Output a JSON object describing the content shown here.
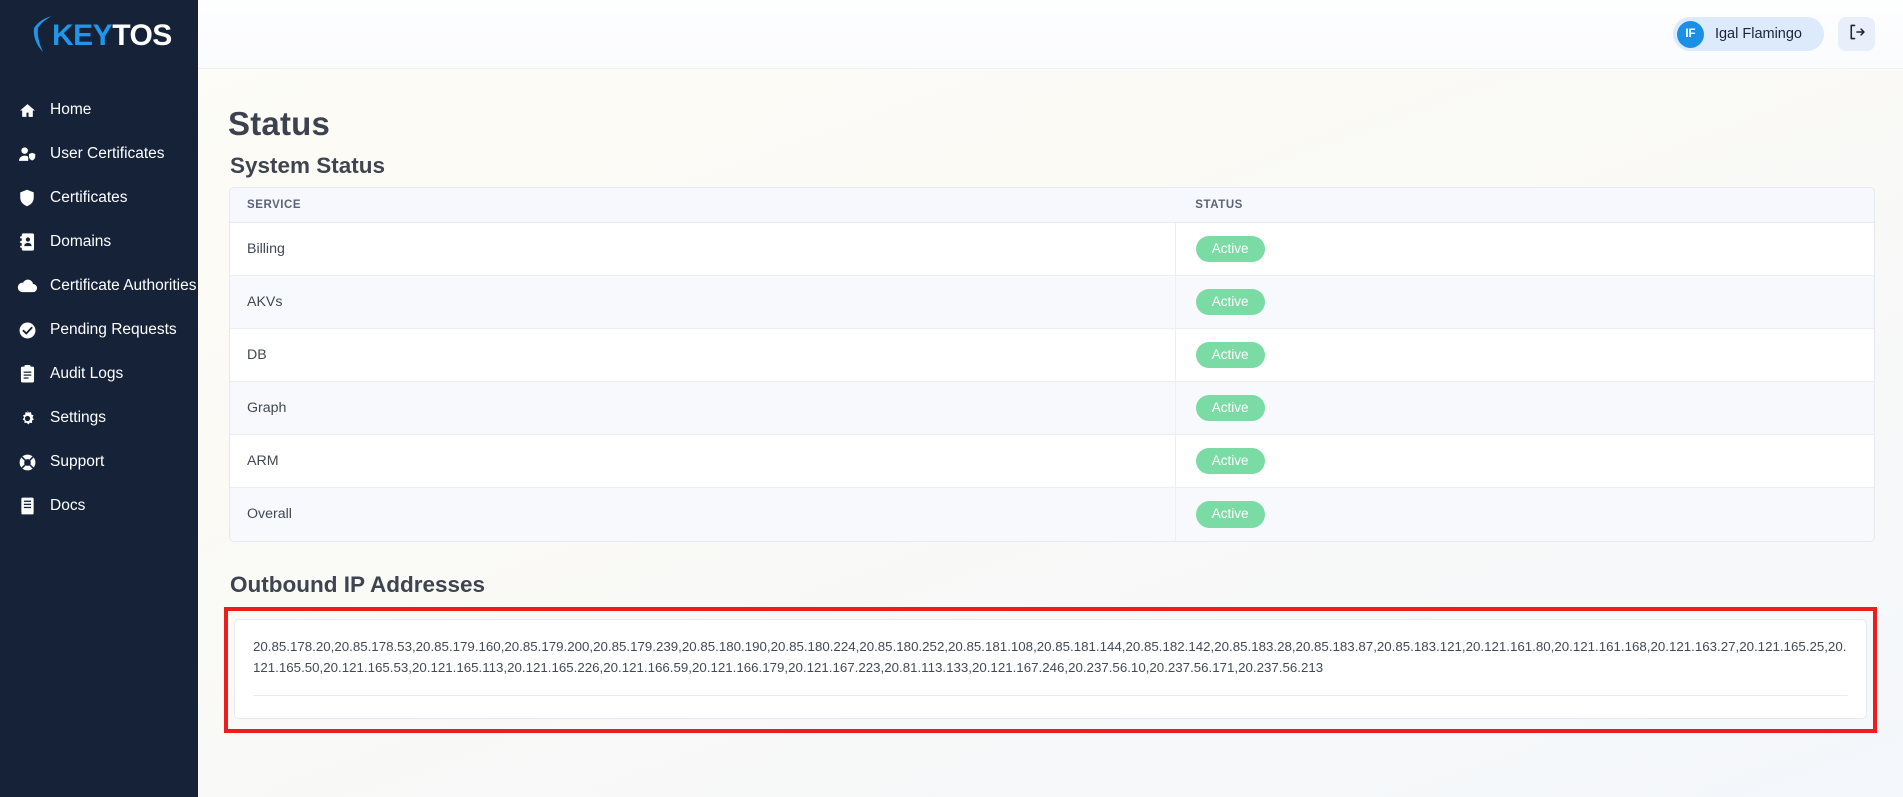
{
  "brand": {
    "logo_primary": "KEY",
    "logo_secondary": "TOS",
    "logo_primary_color": "#2196e8",
    "logo_secondary_color": "#ffffff",
    "sidebar_bg": "#152238"
  },
  "sidebar": {
    "items": [
      {
        "label": "Home",
        "icon": "home-icon"
      },
      {
        "label": "User Certificates",
        "icon": "user-shield-icon"
      },
      {
        "label": "Certificates",
        "icon": "shield-icon"
      },
      {
        "label": "Domains",
        "icon": "address-book-icon"
      },
      {
        "label": "Certificate Authorities",
        "icon": "cloud-icon"
      },
      {
        "label": "Pending Requests",
        "icon": "check-circle-icon"
      },
      {
        "label": "Audit Logs",
        "icon": "clipboard-icon"
      },
      {
        "label": "Settings",
        "icon": "gear-icon"
      },
      {
        "label": "Support",
        "icon": "life-ring-icon"
      },
      {
        "label": "Docs",
        "icon": "book-icon"
      }
    ]
  },
  "topbar": {
    "user_initials": "IF",
    "user_name": "Igal Flamingo",
    "avatar_color": "#1a8fe8",
    "signout_icon": "sign-out-icon"
  },
  "page": {
    "title": "Status",
    "system_status_heading": "System Status",
    "outbound_heading": "Outbound IP Addresses"
  },
  "table": {
    "columns": [
      "SERVICE",
      "STATUS"
    ],
    "badge_color": "#7bdba5",
    "rows": [
      {
        "service": "Billing",
        "status": "Active"
      },
      {
        "service": "AKVs",
        "status": "Active"
      },
      {
        "service": "DB",
        "status": "Active"
      },
      {
        "service": "Graph",
        "status": "Active"
      },
      {
        "service": "ARM",
        "status": "Active"
      },
      {
        "service": "Overall",
        "status": "Active"
      }
    ]
  },
  "outbound_ips": {
    "annotation_color": "#ee1c1c",
    "text": "20.85.178.20,20.85.178.53,20.85.179.160,20.85.179.200,20.85.179.239,20.85.180.190,20.85.180.224,20.85.180.252,20.85.181.108,20.85.181.144,20.85.182.142,20.85.183.28,20.85.183.87,20.85.183.121,20.121.161.80,20.121.161.168,20.121.163.27,20.121.165.25,20.121.165.50,20.121.165.53,20.121.165.113,20.121.165.226,20.121.166.59,20.121.166.179,20.121.167.223,20.81.113.133,20.121.167.246,20.237.56.10,20.237.56.171,20.237.56.213",
    "list": [
      "20.85.178.20",
      "20.85.178.53",
      "20.85.179.160",
      "20.85.179.200",
      "20.85.179.239",
      "20.85.180.190",
      "20.85.180.224",
      "20.85.180.252",
      "20.85.181.108",
      "20.85.181.144",
      "20.85.182.142",
      "20.85.183.28",
      "20.85.183.87",
      "20.85.183.121",
      "20.121.161.80",
      "20.121.161.168",
      "20.121.163.27",
      "20.121.165.25",
      "20.121.165.50",
      "20.121.165.53",
      "20.121.165.113",
      "20.121.165.226",
      "20.121.166.59",
      "20.121.166.179",
      "20.121.167.223",
      "20.81.113.133",
      "20.121.167.246",
      "20.237.56.10",
      "20.237.56.171",
      "20.237.56.213"
    ]
  }
}
